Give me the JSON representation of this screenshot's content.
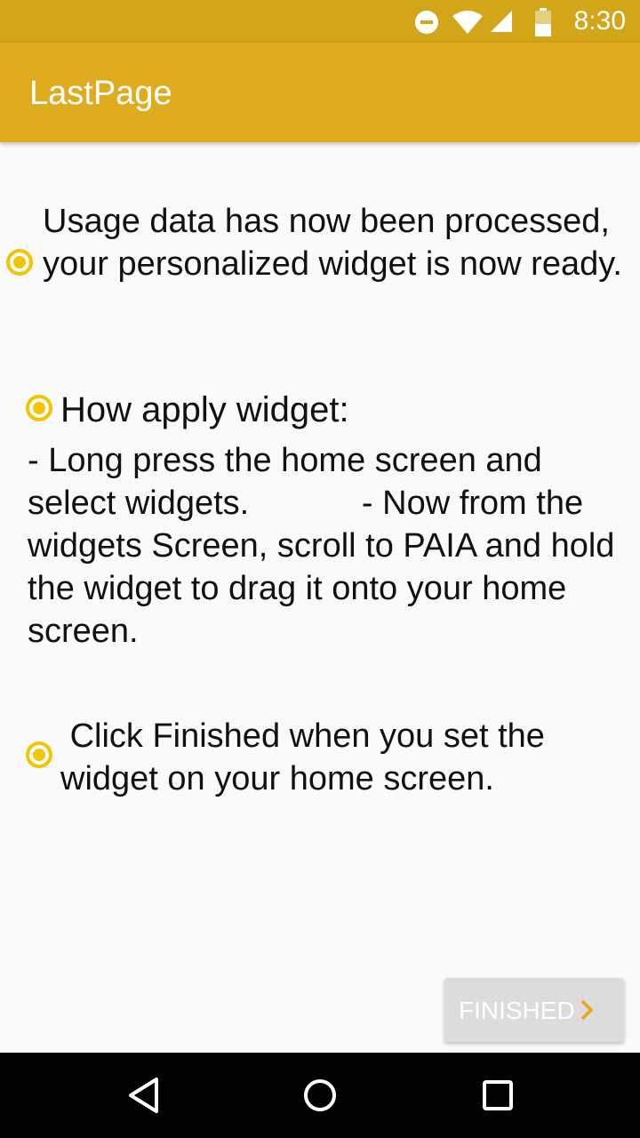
{
  "status_bar": {
    "time": "8:30",
    "icons": [
      "do-not-disturb-icon",
      "wifi-icon",
      "signal-icon",
      "battery-icon"
    ]
  },
  "app_bar": {
    "title": "LastPage"
  },
  "content": {
    "item1": "Usage data has now been processed, your personalized widget is now ready.",
    "heading": "How apply widget:",
    "instructions": "- Long press the home screen and select widgets.            - Now from the widgets Screen, scroll to PAIA and hold the widget to drag it onto your home screen.",
    "item3": " Click Finished when you set the widget on your home screen."
  },
  "finished_button": {
    "label": "FINISHED",
    "icon": "chevron-right-icon"
  },
  "nav_bar": {
    "icons": [
      "back-icon",
      "home-icon",
      "recents-icon"
    ]
  },
  "colors": {
    "status_bar": "#d3a518",
    "app_bar": "#e0ac1f",
    "accent": "#f5c400",
    "background": "#fafafa",
    "button_bg": "#dcdcdc"
  }
}
